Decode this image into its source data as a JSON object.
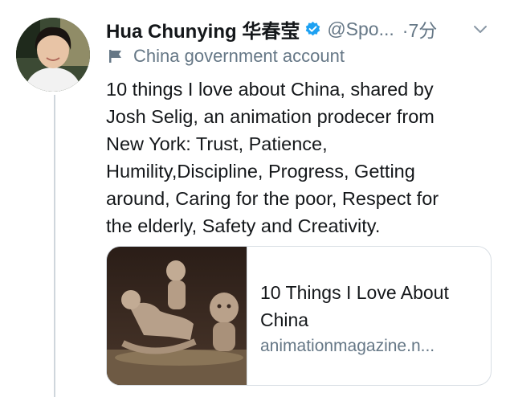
{
  "tweet": {
    "author_name": "Hua Chunying 华春莹",
    "handle": "@Spo...",
    "time": "·7分",
    "account_label": "China government account",
    "text_lines": [
      "10 things I love about China, shared by",
      "Josh Selig, an animation prodecer from",
      "New York: Trust, Patience,",
      "Humility,Discipline, Progress, Getting",
      "around, Caring for the poor, Respect for",
      "the elderly, Safety and Creativity."
    ]
  },
  "card": {
    "title_lines": [
      "10 Things I Love About",
      "China"
    ],
    "domain": "animationmagazine.n..."
  },
  "icons": {
    "verified": "verified-badge-icon",
    "caret": "chevron-down-icon",
    "label": "flag-icon"
  },
  "colors": {
    "text": "#14171a",
    "secondary": "#657786",
    "verified": "#1da1f2",
    "border": "#d8dee4"
  }
}
